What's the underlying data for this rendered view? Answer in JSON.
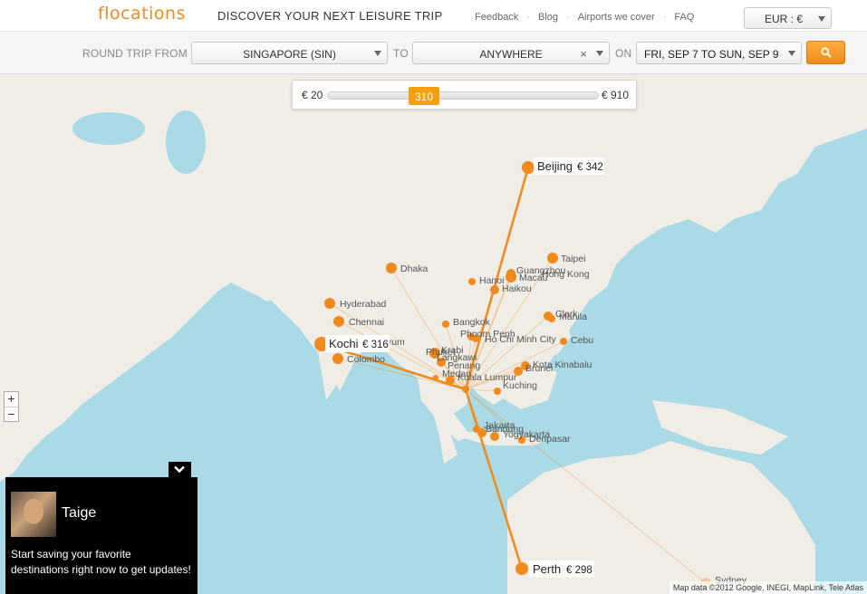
{
  "header": {
    "logo": "flocations",
    "tagline": "DISCOVER YOUR NEXT LEISURE TRIP",
    "nav": [
      "Feedback",
      "Blog",
      "Airports we cover",
      "FAQ"
    ],
    "currency": "EUR : €"
  },
  "search": {
    "from_label": "ROUND TRIP FROM",
    "from_value": "SINGAPORE (SIN)",
    "to_label": "TO",
    "to_value": "ANYWHERE",
    "on_label": "ON",
    "date_value": "FRI, SEP 7 TO SUN, SEP 9"
  },
  "price_slider": {
    "min_label": "€ 20",
    "max_label": "€ 910",
    "current_label": "310"
  },
  "map": {
    "zoom_in": "+",
    "zoom_out": "−",
    "attribution": "Map data ©2012 Google, INEGI, MapLink, Tele Atlas",
    "countries": [
      "Dhaka",
      "Hyderabad",
      "Chennai",
      "Colombo",
      "Bangkok",
      "Phnom Penh",
      "Ho Chi Minh City",
      "Hanoi",
      "Haikou",
      "Guangzhou",
      "Macau",
      "Hong Kong",
      "Taipei",
      "Clark",
      "Manila",
      "Cebu",
      "Kota Kinabalu",
      "Brunei",
      "Kuching",
      "Krabi",
      "Phuket",
      "Langkawi",
      "Penang",
      "Medan",
      "Kuala Lumpur",
      "Bandung",
      "Jakarta",
      "Yogyakarta",
      "Denpasar",
      "Sydney",
      "Trivandrum"
    ],
    "highlighted": [
      {
        "city": "Beijing",
        "price": "€ 342"
      },
      {
        "city": "Kochi",
        "price": "€ 316"
      },
      {
        "city": "Perth",
        "price": "€ 298"
      }
    ]
  },
  "user_panel": {
    "name": "Taige",
    "message": "Start saving your favorite destinations right now to get updates!"
  }
}
